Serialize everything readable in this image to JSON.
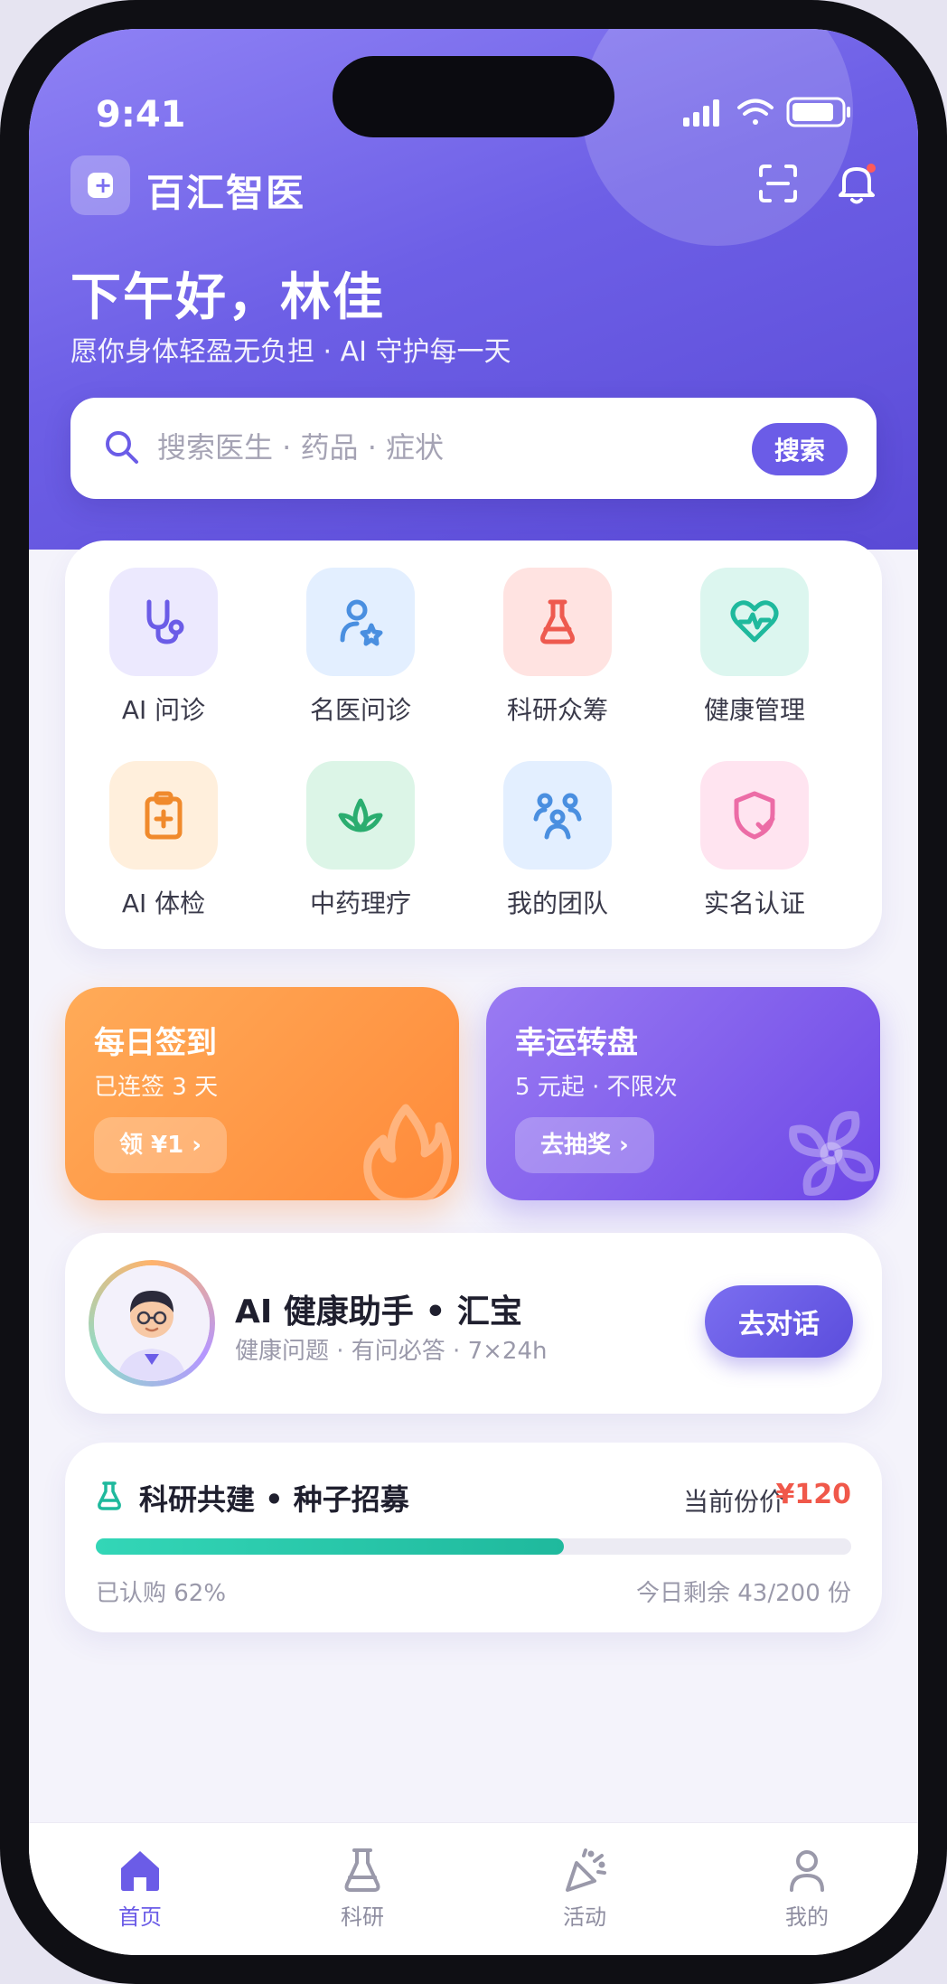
{
  "status_bar": {
    "time": "9:41",
    "signal_icon": "signal-icon",
    "wifi_icon": "wifi-icon",
    "battery_icon": "battery-icon"
  },
  "header": {
    "brand_name": "百汇智医",
    "scan_icon": "scan-icon",
    "bell_icon": "bell-icon",
    "greeting": "下午好，林佳",
    "subtitle": "愿你身体轻盈无负担 · AI 守护每一天"
  },
  "search": {
    "placeholder": "搜索医生 · 药品 · 症状",
    "value": "",
    "button_label": "搜索"
  },
  "features": [
    {
      "label": "AI 问诊",
      "icon": "stethoscope-icon",
      "color": "#6b5ce7",
      "bg": "#ece9fe"
    },
    {
      "label": "名医问诊",
      "icon": "doctor-star-icon",
      "color": "#4a8fe0",
      "bg": "#e3efff"
    },
    {
      "label": "科研众筹",
      "icon": "flask-icon",
      "color": "#ee5a4f",
      "bg": "#ffe3e1"
    },
    {
      "label": "健康管理",
      "icon": "heart-pulse-icon",
      "color": "#1fb99d",
      "bg": "#dcf6ef"
    },
    {
      "label": "AI 体检",
      "icon": "clipboard-medical-icon",
      "color": "#f08a2c",
      "bg": "#ffefdc"
    },
    {
      "label": "中药理疗",
      "icon": "herb-leaf-icon",
      "color": "#2aad6f",
      "bg": "#dcf5e7"
    },
    {
      "label": "我的团队",
      "icon": "team-icon",
      "color": "#4a8fe0",
      "bg": "#e3efff"
    },
    {
      "label": "实名认证",
      "icon": "shield-check-icon",
      "color": "#ec6ca6",
      "bg": "#ffe4f0"
    }
  ],
  "promos": [
    {
      "title": "每日签到",
      "subtitle": "已连签 3 天",
      "button": "领 ¥1 ›",
      "icon": "flame-icon"
    },
    {
      "title": "幸运转盘",
      "subtitle": "5 元起 · 不限次",
      "button": "去抽奖 ›",
      "icon": "pinwheel-icon"
    }
  ],
  "assistant": {
    "title": "AI 健康助手 • 汇宝",
    "subtitle": "健康问题 · 有问必答 · 7×24h",
    "button": "去对话",
    "avatar_icon": "doctor-avatar-icon"
  },
  "research": {
    "icon": "flask-icon",
    "title": "科研共建 • 种子招募",
    "price_label": "当前份价",
    "price": "¥120",
    "progress_percent": 62,
    "progress_text": "已认购 62%",
    "remaining_text": "今日剩余 43/200 份"
  },
  "tabbar": [
    {
      "label": "首页",
      "icon": "home-icon",
      "active": true
    },
    {
      "label": "科研",
      "icon": "flask-icon",
      "active": false
    },
    {
      "label": "活动",
      "icon": "party-popper-icon",
      "active": false
    },
    {
      "label": "我的",
      "icon": "user-icon",
      "active": false
    }
  ],
  "colors": {
    "primary": "#6b5ce7",
    "accent_red": "#f0584a",
    "accent_teal": "#1fb99d",
    "orange": "#ff8a3a"
  }
}
